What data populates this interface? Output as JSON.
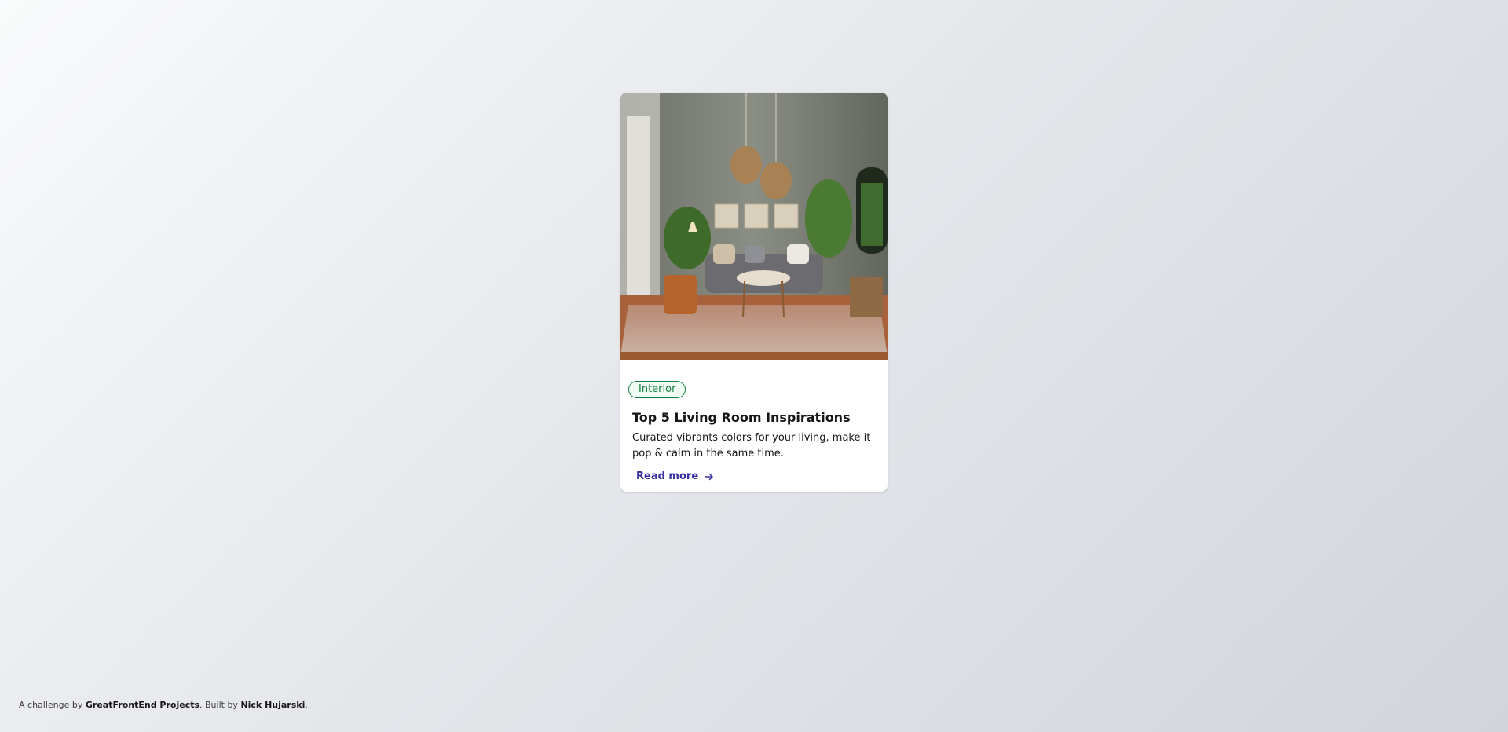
{
  "card": {
    "image_alt": "Living room interior with grey sofa, round coffee table, wicker pendant lamps and plants",
    "badge": "Interior",
    "title": "Top 5 Living Room Inspirations",
    "description": "Curated vibrants colors for your living, make it pop & calm in the same time.",
    "read_more": "Read more",
    "read_more_icon": "arrow-right-icon"
  },
  "footer": {
    "prefix": "A challenge by ",
    "challenge_org": "GreatFrontEnd Projects",
    "middle": ". Built by ",
    "author": "Nick Hujarski",
    "suffix": "."
  },
  "colors": {
    "badge_accent": "#15803d",
    "link_accent": "#3730a3"
  }
}
